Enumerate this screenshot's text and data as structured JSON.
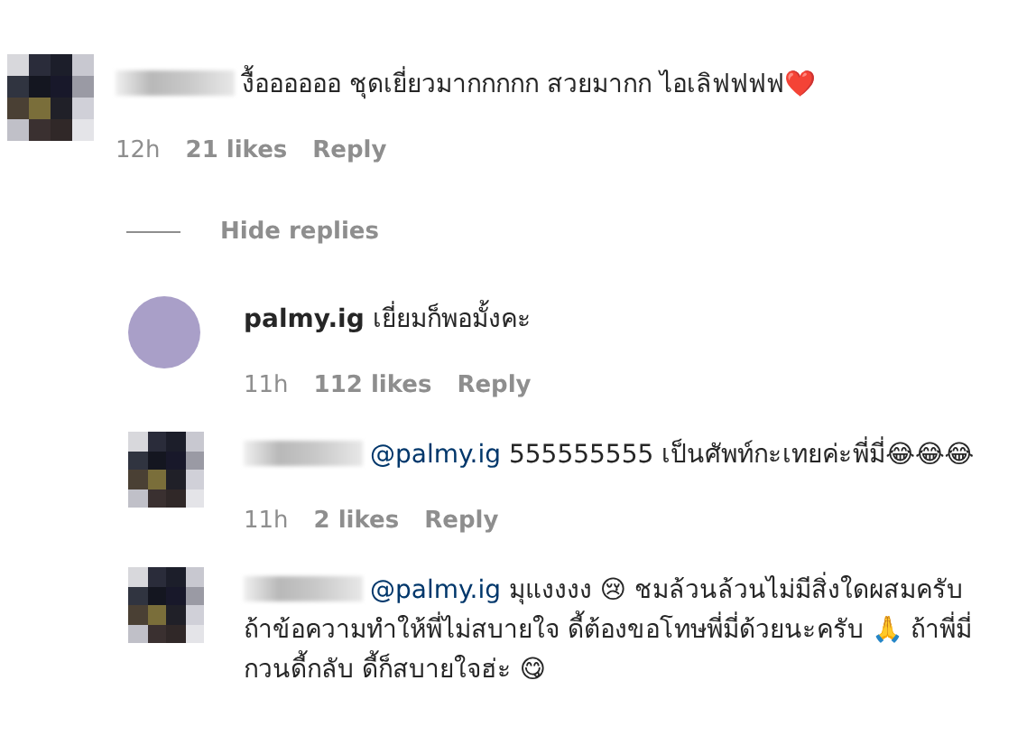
{
  "comments": [
    {
      "avatar": {
        "kind": "pixelated"
      },
      "parts": [
        {
          "kind": "text",
          "text": "งื้ออออออ ชุดเยี่ยวมากกกกก สวยมากก ไอเลิฟฟฟฟ❤️"
        }
      ],
      "time": "12h",
      "likes": "21 likes",
      "reply": "Reply",
      "hide_replies": "Hide replies",
      "replies": [
        {
          "avatar": {
            "kind": "photo"
          },
          "username": "palmy.ig",
          "parts": [
            {
              "kind": "text",
              "text": "เยี่ยมก็พอมั้งคะ"
            }
          ],
          "time": "11h",
          "likes": "112 likes",
          "reply": "Reply"
        },
        {
          "avatar": {
            "kind": "pixelated"
          },
          "parts": [
            {
              "kind": "mention",
              "text": "@palmy.ig"
            },
            {
              "kind": "text",
              "text": " 555555555 เป็นศัพท์กะเทยค่ะพี่มี่😂😂😂"
            }
          ],
          "time": "11h",
          "likes": "2 likes",
          "reply": "Reply"
        },
        {
          "avatar": {
            "kind": "pixelated"
          },
          "parts": [
            {
              "kind": "mention",
              "text": "@palmy.ig"
            },
            {
              "kind": "text",
              "text": " มุแงงงง 😢 ชมล้วนล้วนไม่มีสิ่งใดผสมครับ ถ้าข้อความทำให้พี่ไม่สบายใจ ดี้ต้องขอโทษพี่มี่ด้วยนะครับ 🙏 ถ้าพี่มี่กวนดี้กลับ ดี้ก็สบายใจฮ่ะ 😋"
            }
          ]
        }
      ]
    }
  ]
}
